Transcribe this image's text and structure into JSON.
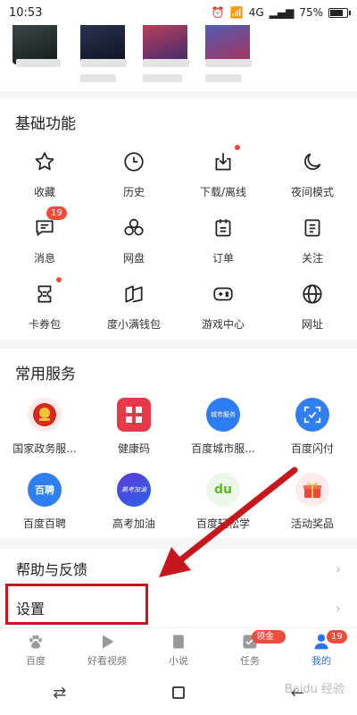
{
  "status": {
    "time": "10:53",
    "network": "4G",
    "battery": "75%",
    "battery_level": 0.75
  },
  "basic": {
    "title": "基础功能",
    "items": [
      {
        "label": "收藏",
        "icon": "star-icon"
      },
      {
        "label": "历史",
        "icon": "clock-icon"
      },
      {
        "label": "下载/离线",
        "icon": "download-icon",
        "dot": true
      },
      {
        "label": "夜间模式",
        "icon": "moon-icon"
      },
      {
        "label": "消息",
        "icon": "message-icon",
        "badge": "19"
      },
      {
        "label": "网盘",
        "icon": "cloud-drive-icon"
      },
      {
        "label": "订单",
        "icon": "order-icon"
      },
      {
        "label": "关注",
        "icon": "follow-icon"
      },
      {
        "label": "卡券包",
        "icon": "coupon-icon",
        "dot": true
      },
      {
        "label": "度小满钱包",
        "icon": "wallet-icon"
      },
      {
        "label": "游戏中心",
        "icon": "gamepad-icon"
      },
      {
        "label": "网址",
        "icon": "globe-icon"
      }
    ]
  },
  "services": {
    "title": "常用服务",
    "items": [
      {
        "label": "国家政务服...",
        "icon": "gov-emblem-icon"
      },
      {
        "label": "健康码",
        "icon": "health-code-icon"
      },
      {
        "label": "百度城市服...",
        "icon": "city-service-icon",
        "inner": "城市服务"
      },
      {
        "label": "百度闪付",
        "icon": "scan-pay-icon"
      },
      {
        "label": "百度百聘",
        "icon": "recruit-icon",
        "inner": "百聘"
      },
      {
        "label": "高考加油",
        "icon": "gaokao-icon",
        "inner": "高考加油"
      },
      {
        "label": "百度轻松学",
        "icon": "easy-learn-icon",
        "inner": "du"
      },
      {
        "label": "活动奖品",
        "icon": "gift-icon"
      }
    ]
  },
  "rows": {
    "help": "帮助与反馈",
    "settings": "设置"
  },
  "tabs": [
    {
      "label": "百度",
      "icon": "paw-icon"
    },
    {
      "label": "好看视频",
      "icon": "play-icon"
    },
    {
      "label": "小说",
      "icon": "book-icon"
    },
    {
      "label": "任务",
      "icon": "task-icon",
      "badge": "领金币"
    },
    {
      "label": "我的",
      "icon": "person-icon",
      "badge": "19",
      "active": true
    }
  ],
  "watermark": "Baidu 经验",
  "colors": {
    "accent": "#2a71f5",
    "badge": "#f24a3b",
    "annotation": "#c8161d"
  }
}
